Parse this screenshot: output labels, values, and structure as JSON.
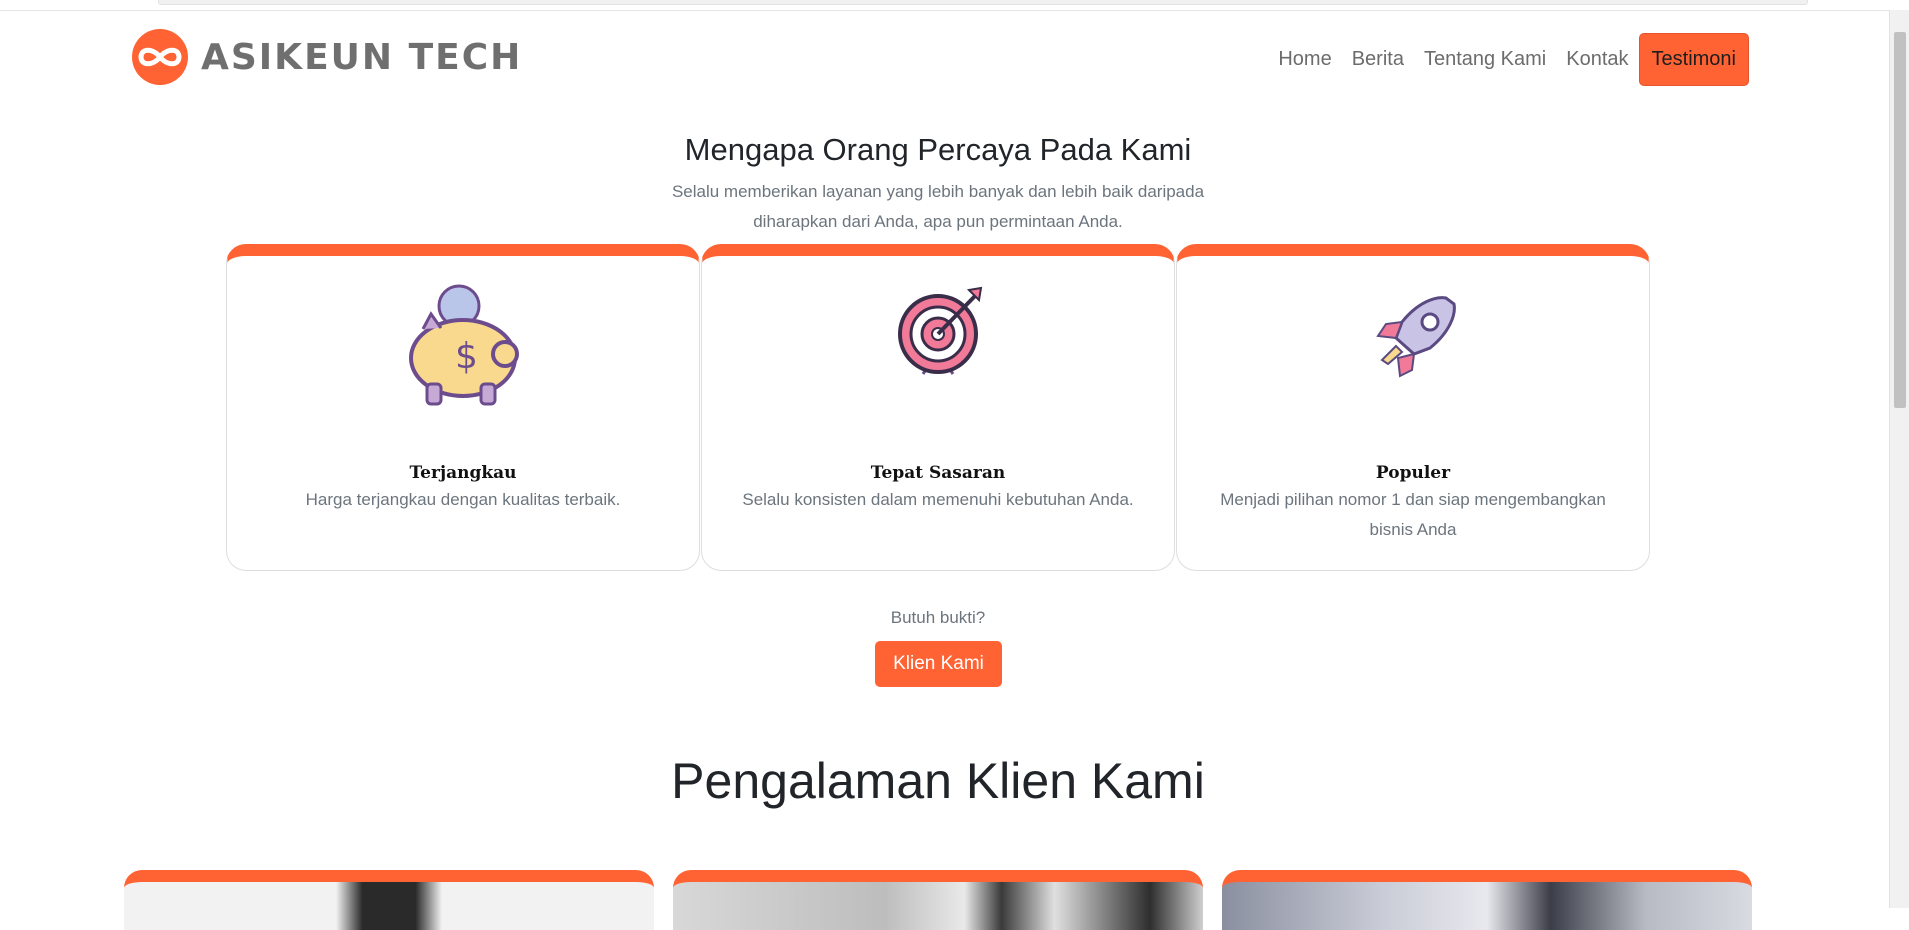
{
  "brand": {
    "name": "ASIKEUN TECH",
    "logo_icon": "infinity-logo-icon",
    "accent": "#ff6333"
  },
  "nav": {
    "items": [
      "Home",
      "Berita",
      "Tentang Kami",
      "Kontak"
    ],
    "cta": "Testimoni"
  },
  "why": {
    "title": "Mengapa Orang Percaya Pada Kami",
    "subtitle": "Selalu memberikan layanan yang lebih banyak dan lebih baik daripada diharapkan dari Anda, apa pun permintaan Anda.",
    "cards": [
      {
        "icon": "piggy-bank-icon",
        "title": "Terjangkau",
        "desc": "Harga terjangkau dengan kualitas terbaik."
      },
      {
        "icon": "target-icon",
        "title": "Tepat Sasaran",
        "desc": "Selalu konsisten dalam memenuhi kebutuhan Anda."
      },
      {
        "icon": "rocket-icon",
        "title": "Populer",
        "desc": "Menjadi pilihan nomor 1 dan siap mengembangkan bisnis Anda"
      }
    ]
  },
  "proof": {
    "question": "Butuh bukti?",
    "button": "Klien Kami"
  },
  "experience": {
    "title": "Pengalaman Klien Kami"
  }
}
